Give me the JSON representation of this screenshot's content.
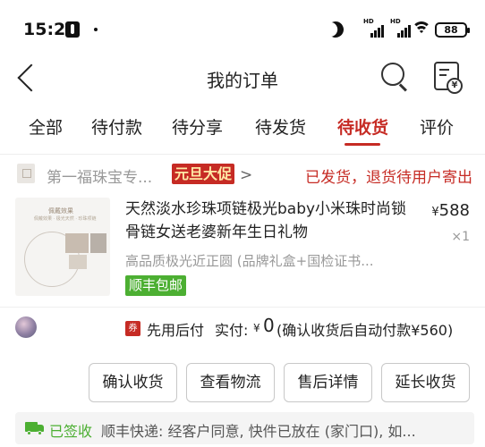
{
  "status_bar": {
    "time": "15:25",
    "network_label_1": "HD",
    "network_label_2": "HD",
    "battery": "88",
    "icons": [
      "tiktok-icon",
      "moon-icon",
      "signal-icon",
      "signal-icon",
      "wifi-icon",
      "battery-icon"
    ]
  },
  "header": {
    "title": "我的订单",
    "icons": [
      "back-icon",
      "search-icon",
      "receipt-icon"
    ]
  },
  "tabs": [
    {
      "label": "全部",
      "active": false
    },
    {
      "label": "待付款",
      "active": false
    },
    {
      "label": "待分享",
      "active": false
    },
    {
      "label": "待发货",
      "active": false
    },
    {
      "label": "待收货",
      "active": true
    },
    {
      "label": "评价",
      "active": false
    }
  ],
  "order": {
    "shop_name": "第一福珠宝专...",
    "promo_badge": "元旦大促",
    "status": "已发货，退货待用户寄出",
    "product": {
      "title": "天然淡水珍珠项链极光baby小米珠时尚锁骨链女送老婆新年生日礼物",
      "price_symbol": "¥",
      "price": "588",
      "quantity": "×1",
      "spec": "高品质极光近正圆 (品牌礼盒+国检证书...",
      "shipping_tag": "顺丰包邮"
    },
    "payment": {
      "coupon_icon_label": "券",
      "method": "先用后付",
      "paid_label": "实付:",
      "paid_currency": "¥",
      "paid_amount": "0",
      "note": "(确认收货后自动付款¥560)"
    },
    "actions": {
      "confirm": "确认收货",
      "logistics": "查看物流",
      "aftersale": "售后详情",
      "extend": "延长收货"
    },
    "delivery": {
      "status": "已签收",
      "text": "顺丰快递: 经客户同意, 快件已放在 (家门口), 如..."
    }
  },
  "colors": {
    "accent": "#c62b24",
    "green": "#4caf32",
    "promo_text": "#ffe9a6"
  }
}
